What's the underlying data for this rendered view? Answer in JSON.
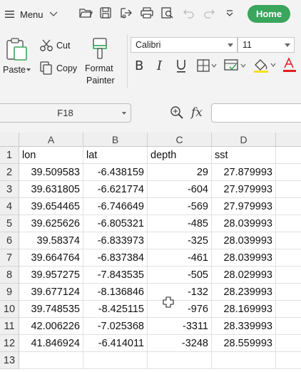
{
  "quickbar": {
    "menu_label": "Menu",
    "home_label": "Home",
    "accent": "#3aa55c"
  },
  "ribbon": {
    "paste_label": "Paste",
    "cut_label": "Cut",
    "copy_label": "Copy",
    "format_painter_line1": "Format",
    "format_painter_line2": "Painter",
    "font_name": "Calibri",
    "font_size": "11",
    "font_color_accent": "#e02020",
    "fill_color_accent": "#f5e11b"
  },
  "formula_bar": {
    "name_box": "F18",
    "fx_label": "fx",
    "formula": ""
  },
  "sheet": {
    "columns": [
      "A",
      "B",
      "C",
      "D"
    ],
    "rows": [
      {
        "n": "1",
        "a": "lon",
        "b": "lat",
        "c": "depth",
        "d": "sst"
      },
      {
        "n": "2",
        "a": "39.509583",
        "b": "-6.438159",
        "c": "29",
        "d": "27.879993"
      },
      {
        "n": "3",
        "a": "39.631805",
        "b": "-6.621774",
        "c": "-604",
        "d": "27.979993"
      },
      {
        "n": "4",
        "a": "39.654465",
        "b": "-6.746649",
        "c": "-569",
        "d": "27.979993"
      },
      {
        "n": "5",
        "a": "39.625626",
        "b": "-6.805321",
        "c": "-485",
        "d": "28.039993"
      },
      {
        "n": "6",
        "a": "39.58374",
        "b": "-6.833973",
        "c": "-325",
        "d": "28.039993"
      },
      {
        "n": "7",
        "a": "39.664764",
        "b": "-6.837384",
        "c": "-461",
        "d": "28.039993"
      },
      {
        "n": "8",
        "a": "39.957275",
        "b": "-7.843535",
        "c": "-505",
        "d": "28.029993"
      },
      {
        "n": "9",
        "a": "39.677124",
        "b": "-8.136846",
        "c": "-132",
        "d": "28.239993"
      },
      {
        "n": "10",
        "a": "39.748535",
        "b": "-8.425115",
        "c": "-976",
        "d": "28.169993"
      },
      {
        "n": "11",
        "a": "42.006226",
        "b": "-7.025368",
        "c": "-3311",
        "d": "28.339993"
      },
      {
        "n": "12",
        "a": "41.846924",
        "b": "-6.414011",
        "c": "-3248",
        "d": "28.559993"
      },
      {
        "n": "13",
        "a": "",
        "b": "",
        "c": "",
        "d": ""
      }
    ]
  }
}
